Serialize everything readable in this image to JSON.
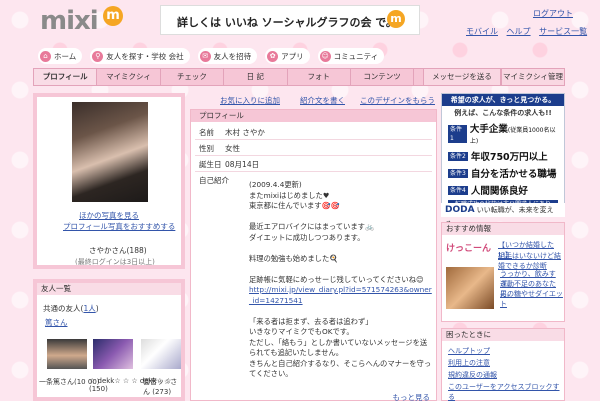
{
  "header": {
    "logo": "mixi",
    "logo_mark": "m",
    "banner_text": "詳しくは いいね ソーシャルグラフの会 で。",
    "banner_mark": "m",
    "logout": "ログアウト",
    "top_links": [
      "モバイル",
      "ヘルプ",
      "サービス一覧"
    ]
  },
  "global_nav": [
    {
      "label": "ホーム"
    },
    {
      "label": "友人を探す・学校 会社"
    },
    {
      "label": "友人を招待"
    },
    {
      "label": "アプリ"
    },
    {
      "label": "コミュニティ"
    }
  ],
  "tabs": [
    "プロフィール",
    "マイミクシィ",
    "チェック",
    "日 記",
    "フォト",
    "コンテンツ"
  ],
  "tab_message": "メッセージを送る",
  "tab_admin": "マイミクシィ管理",
  "profile_card": {
    "more_photos": "ほかの写真を見る",
    "recommend": "プロフィール写真をおすすめする",
    "name": "さやかさん(188)",
    "last_login": "(最終ログインは3日以上)"
  },
  "friends": {
    "title": "友人一覧",
    "common_label": "共通の友人(",
    "common_count": "1人",
    "common_close": ")",
    "common_name": "篤さん",
    "names": [
      "一条篤さん(10 00)",
      "☆ dekk☆ ☆ ☆ dekk☆ ☆ (150)",
      "雲音ッ☆さん (273)"
    ]
  },
  "mid_links": [
    "お気に入りに追加",
    "紹介文を書く",
    "このデザインをもらう"
  ],
  "profile": {
    "title": "プロフィール",
    "rows": [
      {
        "label": "名前",
        "value": "木村 さやか"
      },
      {
        "label": "性別",
        "value": "女性"
      },
      {
        "label": "誕生日",
        "value": "08月14日"
      },
      {
        "label": "自己紹介",
        "value": ""
      }
    ],
    "bio": [
      "(2009.4.4更新)",
      "またmixiはじめました♥",
      "東京都に住んでいます🎯🎯",
      "",
      "最近エアロバイクにはまっています🚲",
      "ダイエットに成功しつつあります。",
      "",
      "料理の勉強も始めました🍳",
      "",
      "足跡帳に気軽にめっせーじ残していってくださいね😊",
      "http://mixi.jp/view_diary.pl?id=571574263&owner_id=14271541",
      "",
      "「来る者は拒まず、去る者は追わず」",
      "いきなりマイミクでもOKです。",
      "ただし、「絡もう」としか書いていないメッセージを送られても追記いたしません。",
      "きちんと自己紹介するなり、そこらへんのマナーを守ってください。"
    ],
    "more": "もっと見る"
  },
  "ad": {
    "header": "希望の求人が、きっと見つかる。",
    "sub": "例えば、こんな条件の求人も!!",
    "items": [
      {
        "badge": "条件1",
        "text": "大手企業",
        "small": "(従業員1000名以上)"
      },
      {
        "badge": "条件2",
        "text": "年収750万円以上",
        "small": ""
      },
      {
        "badge": "条件3",
        "text": "自分を活かせる職場",
        "small": ""
      },
      {
        "badge": "条件4",
        "text": "人間関係良好",
        "small": ""
      }
    ],
    "foot": "転職成功の秘訣は非公開求人にあり",
    "brand": "DODA",
    "brand_tag": "いい転職が、未来を変える。"
  },
  "recommend": {
    "title": "おすすめ情報",
    "logo": "けっこーん",
    "link1": "【いつか結婚したい】",
    "link2": "相手はいないけど結婚できるか診断",
    "t1": "うっかり、飲みすぎ、",
    "t2": "運動不足のあなたに。",
    "t3": "男の糖やせダイエット"
  },
  "help": {
    "title": "困ったときに",
    "items": [
      "ヘルプトップ",
      "利用上の注意",
      "規約違反の通報",
      "このユーザーをアクセスブロックする"
    ]
  }
}
